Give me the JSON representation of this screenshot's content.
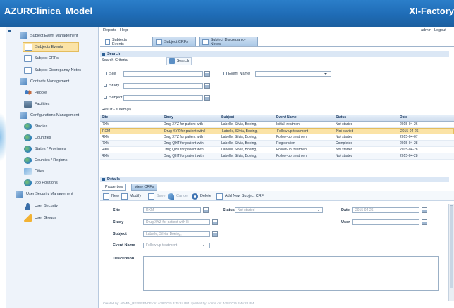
{
  "header": {
    "title": "AZURClinica_Model",
    "brand": "XI-Factory"
  },
  "sidebar": {
    "items": [
      {
        "label": "Subject Event Management",
        "icon": "folder-group-icon"
      },
      {
        "label": "Subjects Events",
        "icon": "form-icon",
        "selected": true
      },
      {
        "label": "Subject CRFs",
        "icon": "form-icon"
      },
      {
        "label": "Subject Discrepancy Notes",
        "icon": "form-icon"
      },
      {
        "label": "Contacts Management",
        "icon": "folder-group-icon"
      },
      {
        "label": "People",
        "icon": "people-icon"
      },
      {
        "label": "Facilities",
        "icon": "building-icon"
      },
      {
        "label": "Configurations Management",
        "icon": "folder-group-icon"
      },
      {
        "label": "Studies",
        "icon": "globe-icon"
      },
      {
        "label": "Countries",
        "icon": "globe-icon"
      },
      {
        "label": "States / Provinces",
        "icon": "globe-icon"
      },
      {
        "label": "Counties / Regions",
        "icon": "globe-icon"
      },
      {
        "label": "Cities",
        "icon": "map-icon"
      },
      {
        "label": "Job Positions",
        "icon": "globe-icon"
      },
      {
        "label": "User Security Management",
        "icon": "folder-group-icon"
      },
      {
        "label": "User Security",
        "icon": "user-icon"
      },
      {
        "label": "User Groups",
        "icon": "warning-icon"
      }
    ]
  },
  "menubar": {
    "reports": "Reports",
    "help": "Help",
    "user": "admin",
    "logout": "Logout"
  },
  "tabs": [
    {
      "label": "Subjects Events",
      "active": true
    },
    {
      "label": "Subject CRFs",
      "active": false
    },
    {
      "label": "Subject Discrepancy Notes",
      "active": false
    }
  ],
  "search": {
    "section_title": "Search",
    "criteria_tab": "Search Criteria",
    "search_button": "Search",
    "fields": {
      "site": "Site",
      "study": "Study",
      "subject": "Subject",
      "event_name": "Event Name"
    }
  },
  "results": {
    "label": "Result - 6 item(s)",
    "columns": [
      "Site",
      "Study",
      "Subject",
      "Event Name",
      "Status",
      "Date"
    ],
    "rows": [
      [
        "RXM",
        "Drug XYZ for patient with l",
        "Labelle, Silvia, Boeing,",
        "Initial treatment",
        "Not started",
        "2015-04-26"
      ],
      [
        "RXM",
        "Drug XYZ for patient with l",
        "Labelle, Silvia, Boeing,",
        "Follow-up treatment",
        "Not started",
        "2015-04-26"
      ],
      [
        "RXM",
        "Drug XYZ for patient with l",
        "Labelle, Silvia, Boeing,",
        "Follow-up treatment",
        "Not started",
        "2015-04-07"
      ],
      [
        "RXM",
        "Drug QHT for patient with",
        "Labelle, Silvia, Boeing,",
        "Registration",
        "Completed",
        "2015-04-28"
      ],
      [
        "RXM",
        "Drug QHT for patient with",
        "Labelle, Silvia, Boeing,",
        "Follow-up treatment",
        "Not started",
        "2015-04-28"
      ],
      [
        "RXM",
        "Drug QHT for patient with",
        "Labelle, Silvia, Boeing,",
        "Follow-up treatment",
        "Not started",
        "2015-04-28"
      ]
    ],
    "selected_row": 1
  },
  "details": {
    "section_title": "Details",
    "tabs": [
      "Properties",
      "View CRFs"
    ],
    "toolbar": [
      "New",
      "Modify",
      "Save",
      "Cancel",
      "Delete",
      "Add New Subject CRF"
    ],
    "labels": {
      "site": "Site",
      "study": "Study",
      "subject": "Subject",
      "event_name": "Event Name",
      "description": "Description",
      "status": "Status",
      "date": "Date",
      "user": "User"
    },
    "values": {
      "site": "RXM",
      "study": "Drug XYZ for patient with lli",
      "subject": "Labelle, Silvia, Boeing,",
      "event_name": "Follow-up treatment",
      "status": "Not started",
      "date": "2015-04-26"
    }
  },
  "status_bar": "Created by: ADMIN_REFERENCE on: 4/28/2015 3:45:24 PM  Updated by: admin on: 4/28/2015 3:46:28 PM"
}
